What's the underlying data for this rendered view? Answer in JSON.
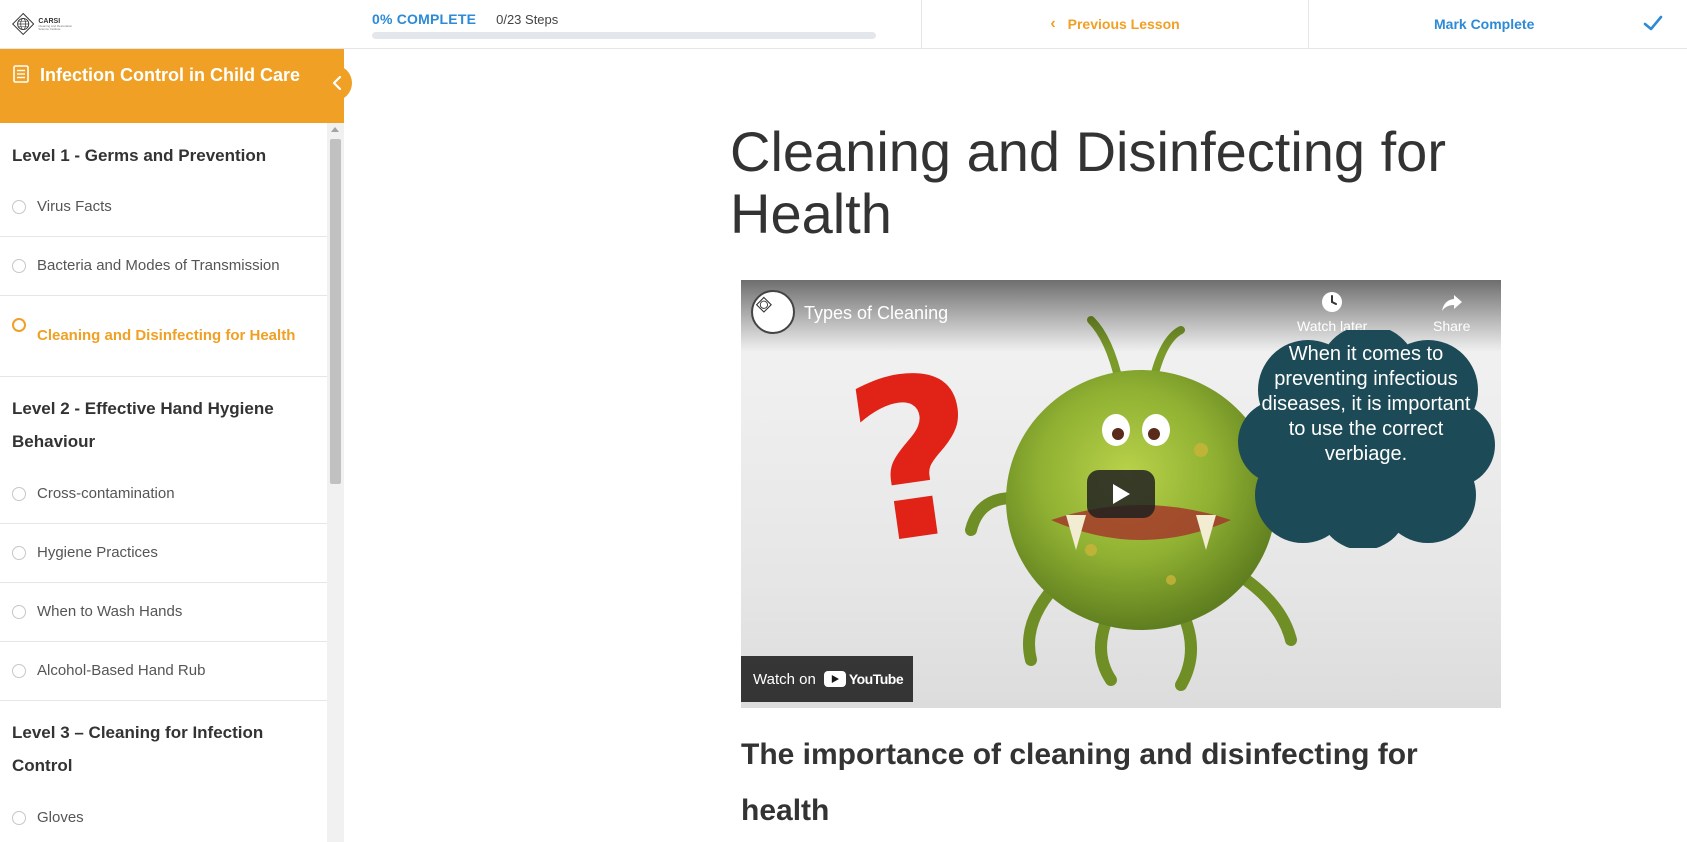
{
  "brand": {
    "logo_text": "CARSI",
    "logo_subtext": "Cleaning and Restoration Science Institute"
  },
  "progress": {
    "percent_label": "0% COMPLETE",
    "steps_label": "0/23 Steps",
    "fraction": 0
  },
  "nav": {
    "previous_label": "Previous Lesson",
    "mark_complete_label": "Mark Complete"
  },
  "course": {
    "title": "Infection Control in Child Care"
  },
  "sidebar": {
    "sections": [
      {
        "title": "Level 1 - Germs and Prevention",
        "lessons": [
          {
            "label": "Virus Facts",
            "active": false
          },
          {
            "label": "Bacteria and Modes of Transmission",
            "active": false
          },
          {
            "label": "Cleaning and Disinfecting for Health",
            "active": true
          }
        ]
      },
      {
        "title": "Level 2 - Effective Hand Hygiene Behaviour",
        "lessons": [
          {
            "label": "Cross-contamination",
            "active": false
          },
          {
            "label": "Hygiene Practices",
            "active": false
          },
          {
            "label": "When to Wash Hands",
            "active": false
          },
          {
            "label": "Alcohol-Based Hand Rub",
            "active": false
          }
        ]
      },
      {
        "title": "Level 3 – Cleaning for Infection Control",
        "lessons": [
          {
            "label": "Gloves",
            "active": false
          }
        ]
      }
    ]
  },
  "main": {
    "title": "Cleaning and Disinfecting for Health",
    "video": {
      "title": "Types of Cleaning",
      "watch_later_label": "Watch later",
      "share_label": "Share",
      "cloud_text": "When it comes to preventing infectious diseases, it is important to use the correct verbiage.",
      "watch_on_label": "Watch on",
      "youtube_wordmark": "YouTube"
    },
    "subheading": "The importance of cleaning and disinfecting for health"
  },
  "colors": {
    "accent_orange": "#f0a024",
    "accent_blue": "#2c8ad6",
    "question_red": "#e02316",
    "cloud_teal": "#1d4a57"
  }
}
